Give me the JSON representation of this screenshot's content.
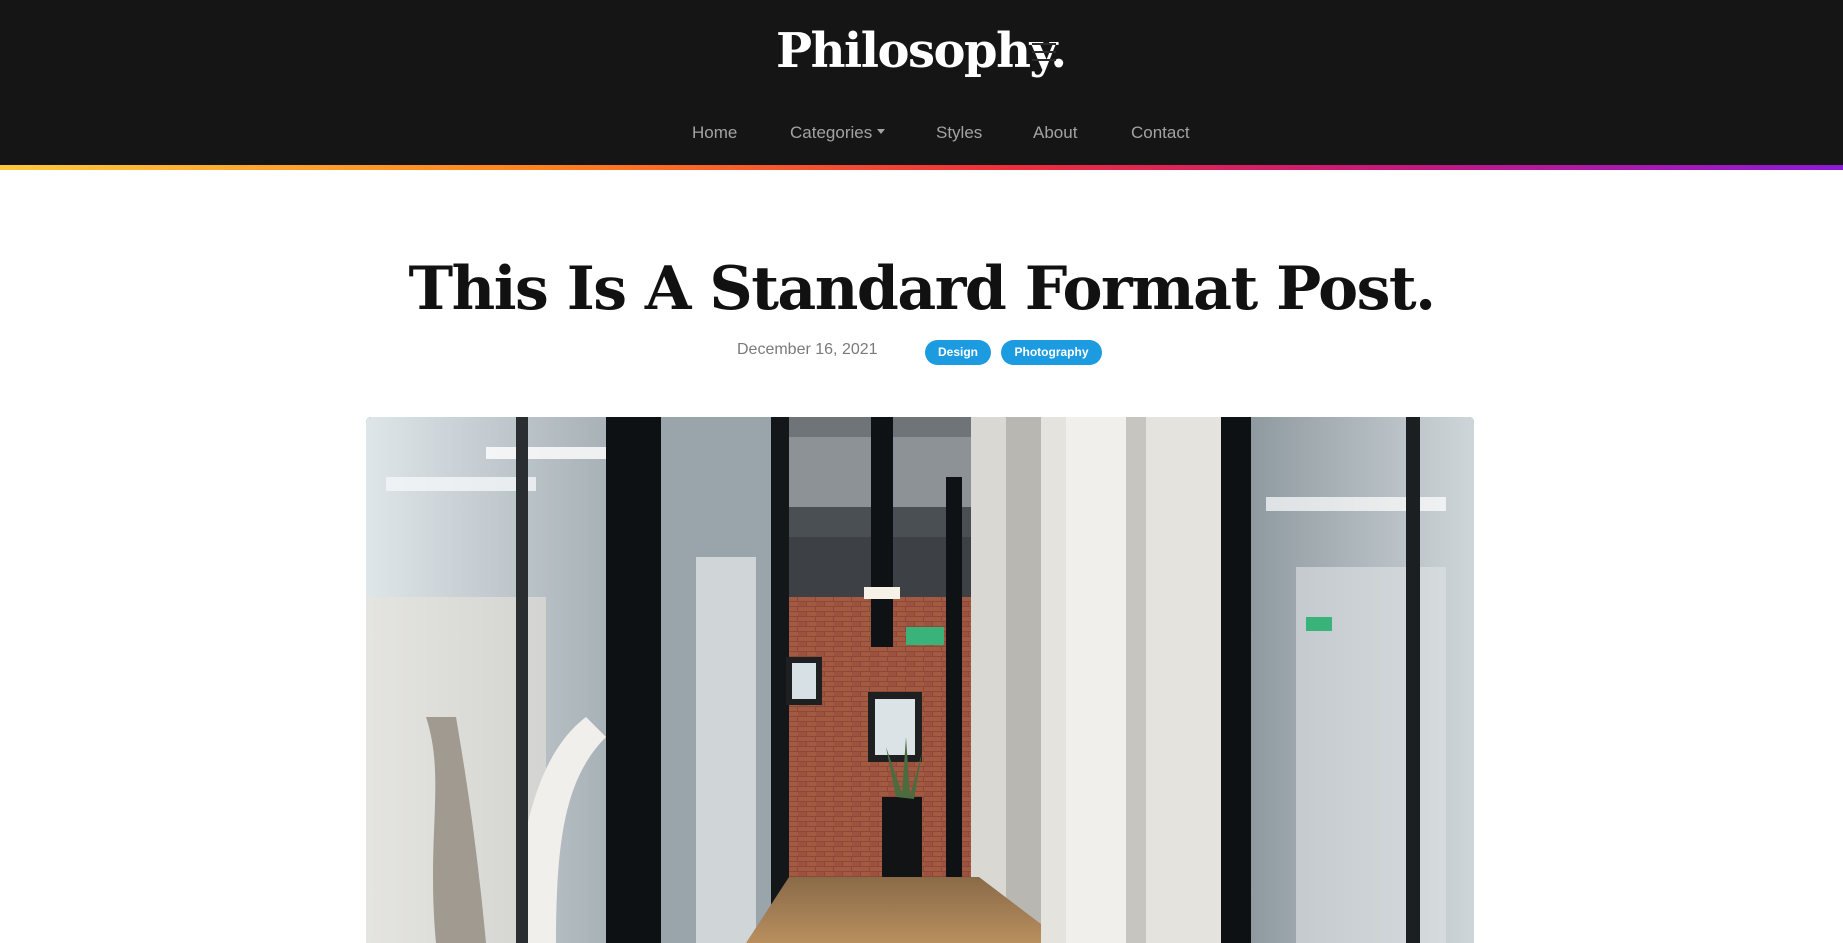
{
  "site": {
    "logo": "Philosophy.",
    "menu_icon": "hamburger-menu-icon"
  },
  "nav": {
    "items": [
      {
        "label": "Home"
      },
      {
        "label": "Categories",
        "has_dropdown": true,
        "dropdown_icon": "caret-down-icon"
      },
      {
        "label": "Styles"
      },
      {
        "label": "About"
      },
      {
        "label": "Contact"
      }
    ]
  },
  "colors": {
    "header_bg": "#151515",
    "nav_text": "#a3a3a3",
    "tag_bg": "#1d9be0",
    "accent_gradient": [
      "#ffc93b",
      "#ff7f1e",
      "#ef2d3c",
      "#c8187a",
      "#8d1ad9"
    ]
  },
  "post": {
    "title": "This Is A Standard Format Post.",
    "date": "December 16, 2021",
    "tags": [
      {
        "label": "Design"
      },
      {
        "label": "Photography"
      }
    ]
  }
}
